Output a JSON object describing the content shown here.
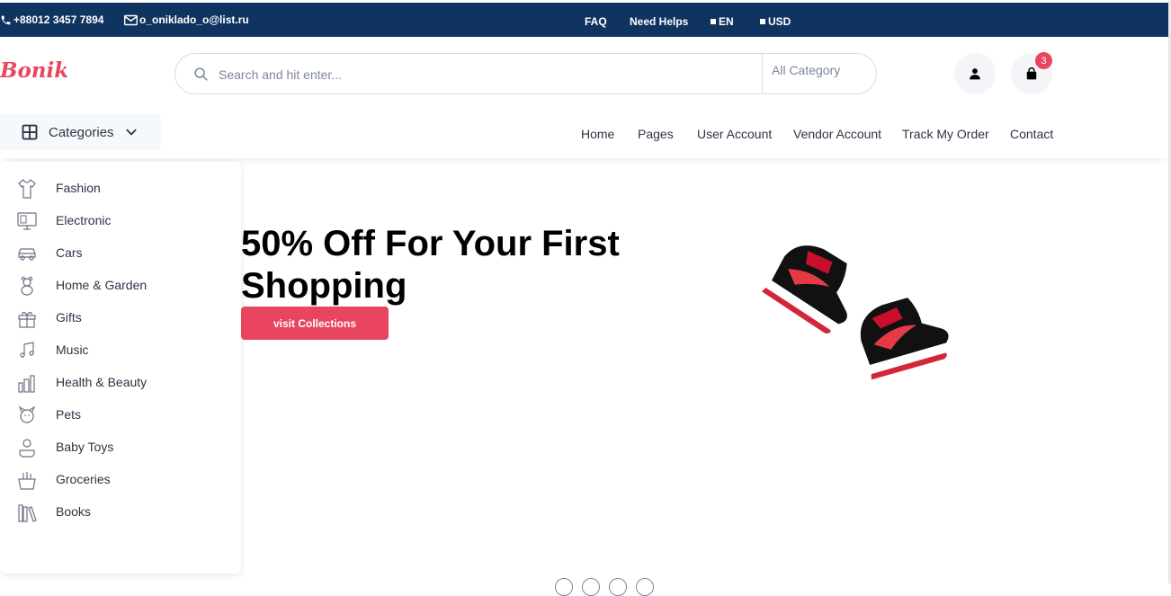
{
  "topbar": {
    "phone": "+88012 3457 7894",
    "email": "o_oniklado_o@list.ru",
    "faq": "FAQ",
    "help": "Need Helps",
    "language": "EN",
    "currency": "USD"
  },
  "header": {
    "logo": "Bonik",
    "search_placeholder": "Search and hit enter...",
    "category_select": "All Category",
    "cart_count": "3"
  },
  "categories_button": "Categories",
  "nav": [
    "Home",
    "Pages",
    "User Account",
    "Vendor Account",
    "Track My Order",
    "Contact"
  ],
  "category_list": [
    {
      "label": "Fashion",
      "icon": "dress-icon"
    },
    {
      "label": "Electronic",
      "icon": "monitor-icon"
    },
    {
      "label": "Cars",
      "icon": "car-icon"
    },
    {
      "label": "Home & Garden",
      "icon": "teddy-bear-icon"
    },
    {
      "label": "Gifts",
      "icon": "gift-icon"
    },
    {
      "label": "Music",
      "icon": "music-icon"
    },
    {
      "label": "Health & Beauty",
      "icon": "cosmetics-icon"
    },
    {
      "label": "Pets",
      "icon": "pet-icon"
    },
    {
      "label": "Baby Toys",
      "icon": "baby-toy-icon"
    },
    {
      "label": "Groceries",
      "icon": "basket-icon"
    },
    {
      "label": "Books",
      "icon": "books-icon"
    }
  ],
  "hero": {
    "title": "50% Off For Your First Shopping",
    "button": "visit Collections"
  },
  "colors": {
    "topbar": "#0f3460",
    "accent": "#e94560",
    "text": "#2b3445"
  }
}
